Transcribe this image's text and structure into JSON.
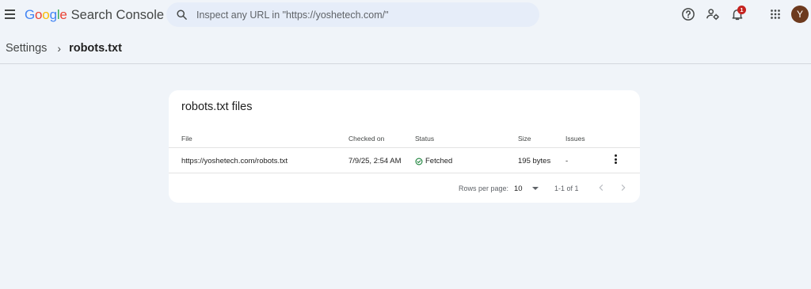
{
  "header": {
    "logo_google": "Google",
    "logo_product": "Search Console",
    "search_placeholder": "Inspect any URL in \"https://yoshetech.com/\"",
    "notification_count": "1",
    "avatar_initial": "Y",
    "icons": [
      "menu-icon",
      "search-icon",
      "help-icon",
      "manage-users-icon",
      "notifications-icon",
      "apps-grid-icon"
    ]
  },
  "breadcrumb": {
    "parent": "Settings",
    "separator": "›",
    "current": "robots.txt"
  },
  "card": {
    "title": "robots.txt files",
    "columns": [
      "File",
      "Checked on",
      "Status",
      "Size",
      "Issues"
    ],
    "rows": [
      {
        "file": "https://yoshetech.com/robots.txt",
        "checked_on": "7/9/25, 2:54 AM",
        "status": "Fetched",
        "size": "195 bytes",
        "issues": "-"
      }
    ],
    "footer": {
      "rows_per_page_label": "Rows per page:",
      "rows_per_page_value": "10",
      "range": "1-1 of 1"
    }
  },
  "colors": {
    "background": "#f0f4f9",
    "search_bg": "#e6edf9",
    "card_bg": "#ffffff",
    "status_green": "#188038",
    "badge_red": "#c5221f",
    "avatar_bg": "#6d3a1e"
  }
}
